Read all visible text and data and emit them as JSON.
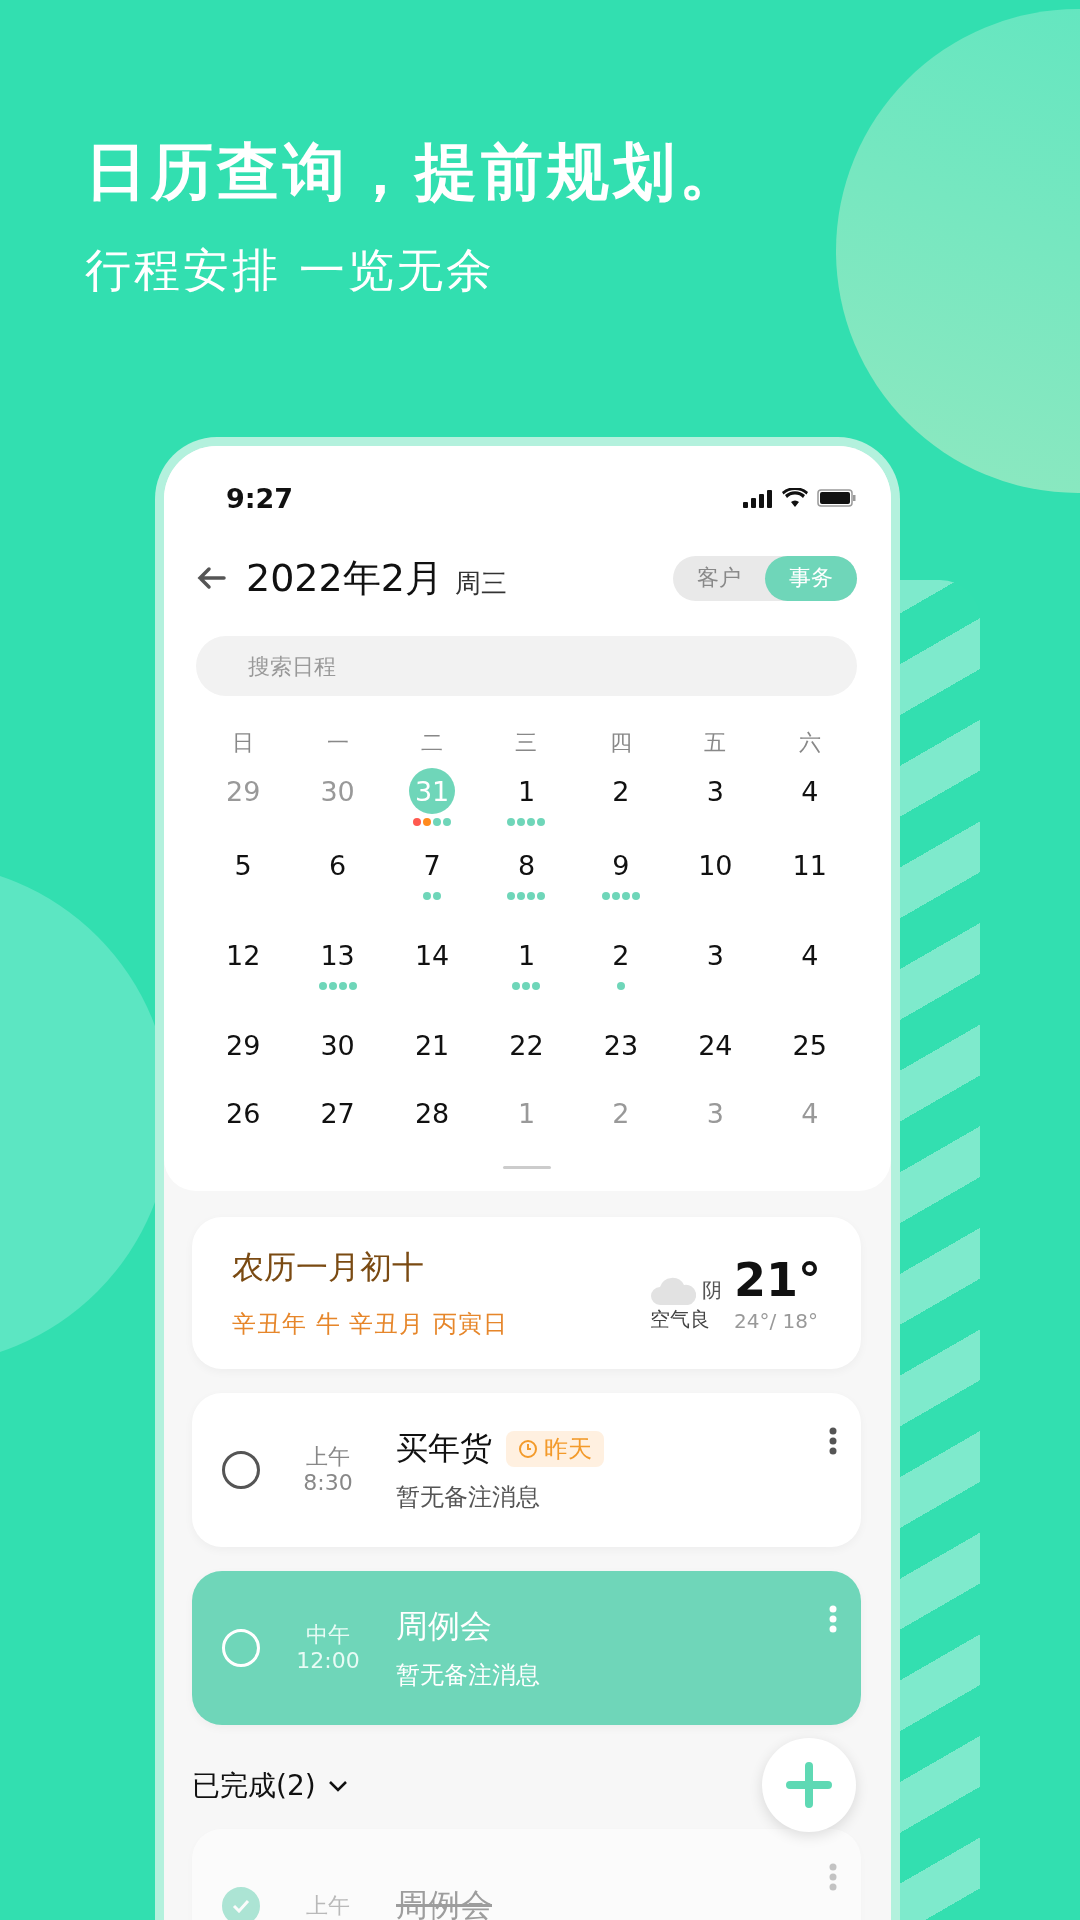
{
  "headline": "日历查询，提前规划。",
  "subheadline": "行程安排 一览无余",
  "status_bar": {
    "time": "9:27"
  },
  "header": {
    "title": "2022年2月",
    "weekday": "周三"
  },
  "tabs": [
    {
      "label": "客户",
      "selected": false
    },
    {
      "label": "事务",
      "selected": true
    }
  ],
  "search": {
    "placeholder": "搜索日程"
  },
  "calendar": {
    "weekdays": [
      "日",
      "一",
      "二",
      "三",
      "四",
      "五",
      "六"
    ],
    "weeks": [
      [
        {
          "day": "29",
          "muted": true,
          "selected": false
        },
        {
          "day": "30",
          "muted": true,
          "selected": false
        },
        {
          "day": "31",
          "muted": false,
          "selected": true,
          "events": [
            {
              "color": "#ff5a4f"
            },
            {
              "color": "#ff8a1e"
            },
            {
              "color": "#6fd6b9"
            },
            {
              "color": "#6fd6b9"
            }
          ]
        },
        {
          "day": "1",
          "muted": false,
          "selected": false,
          "events": [
            {
              "color": "#6fd6b9"
            },
            {
              "color": "#6fd6b9"
            },
            {
              "color": "#6fd6b9"
            },
            {
              "color": "#6fd6b9"
            }
          ]
        },
        {
          "day": "2",
          "muted": false,
          "selected": false
        },
        {
          "day": "3",
          "muted": false,
          "selected": false
        },
        {
          "day": "4",
          "muted": false,
          "selected": false
        }
      ],
      [
        {
          "day": "5",
          "muted": false,
          "selected": false
        },
        {
          "day": "6",
          "muted": false,
          "selected": false
        },
        {
          "day": "7",
          "muted": false,
          "selected": false,
          "events": [
            {
              "color": "#6fd6b9"
            },
            {
              "color": "#6fd6b9"
            }
          ]
        },
        {
          "day": "8",
          "muted": false,
          "selected": false,
          "events": [
            {
              "color": "#6fd6b9"
            },
            {
              "color": "#6fd6b9"
            },
            {
              "color": "#6fd6b9"
            },
            {
              "color": "#6fd6b9"
            }
          ]
        },
        {
          "day": "9",
          "muted": false,
          "selected": false,
          "events": [
            {
              "color": "#6fd6b9"
            },
            {
              "color": "#6fd6b9"
            },
            {
              "color": "#6fd6b9"
            },
            {
              "color": "#6fd6b9"
            }
          ]
        },
        {
          "day": "10",
          "muted": false,
          "selected": false
        },
        {
          "day": "11",
          "muted": false,
          "selected": false
        }
      ],
      [
        {
          "day": "12",
          "muted": false,
          "selected": false
        },
        {
          "day": "13",
          "muted": false,
          "selected": false,
          "events": [
            {
              "color": "#6fd6b9"
            },
            {
              "color": "#6fd6b9"
            },
            {
              "color": "#6fd6b9"
            },
            {
              "color": "#6fd6b9"
            }
          ]
        },
        {
          "day": "14",
          "muted": false,
          "selected": false
        },
        {
          "day": "1",
          "muted": false,
          "selected": false,
          "events": [
            {
              "color": "#6fd6b9"
            },
            {
              "color": "#6fd6b9"
            },
            {
              "color": "#6fd6b9"
            }
          ]
        },
        {
          "day": "2",
          "muted": false,
          "selected": false,
          "events": [
            {
              "color": "#6fd6b9"
            }
          ]
        },
        {
          "day": "3",
          "muted": false,
          "selected": false
        },
        {
          "day": "4",
          "muted": false,
          "selected": false
        }
      ],
      [
        {
          "day": "29",
          "muted": false,
          "selected": false
        },
        {
          "day": "30",
          "muted": false,
          "selected": false
        },
        {
          "day": "21",
          "muted": false,
          "selected": false
        },
        {
          "day": "22",
          "muted": false,
          "selected": false
        },
        {
          "day": "23",
          "muted": false,
          "selected": false
        },
        {
          "day": "24",
          "muted": false,
          "selected": false
        },
        {
          "day": "25",
          "muted": false,
          "selected": false
        }
      ],
      [
        {
          "day": "26",
          "muted": false,
          "selected": false
        },
        {
          "day": "27",
          "muted": false,
          "selected": false
        },
        {
          "day": "28",
          "muted": false,
          "selected": false
        },
        {
          "day": "1",
          "muted": true,
          "selected": false
        },
        {
          "day": "2",
          "muted": true,
          "selected": false
        },
        {
          "day": "3",
          "muted": true,
          "selected": false
        },
        {
          "day": "4",
          "muted": true,
          "selected": false
        }
      ]
    ]
  },
  "lunar": {
    "date": "农历一月初十",
    "ganzhi": "辛丑年 牛 辛丑月 丙寅日"
  },
  "weather": {
    "condition": "阴",
    "temperature": "21°",
    "air": "空气良",
    "range": "24°/ 18°"
  },
  "tasks": [
    {
      "period": "上午",
      "time": "8:30",
      "title": "买年货",
      "tag": "昨天",
      "note": "暂无备注消息",
      "selected": false,
      "checked": false
    },
    {
      "period": "中午",
      "time": "12:00",
      "title": "周例会",
      "note": "暂无备注消息",
      "selected": true,
      "checked": false
    }
  ],
  "completed": {
    "label": "已完成(2)",
    "tasks": [
      {
        "period": "上午",
        "title": "周例会",
        "selected": false,
        "checked": true
      }
    ]
  }
}
